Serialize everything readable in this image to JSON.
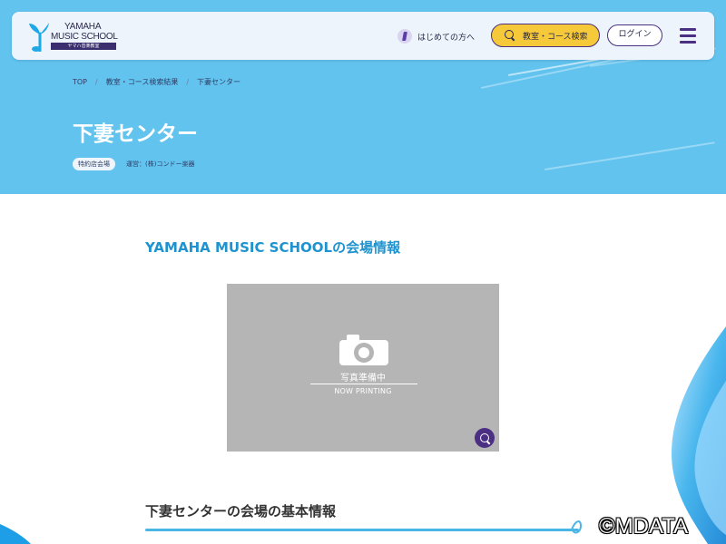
{
  "header": {
    "logo": {
      "line1": "YAMAHA",
      "line2": "MUSIC SCHOOL",
      "sub": "ヤマハ音楽教室"
    },
    "nav_first_label": "はじめての方へ",
    "search_label": "教室・コース検索",
    "login_label": "ログイン"
  },
  "breadcrumb": {
    "items": [
      "TOP",
      "教室・コース検索結果",
      "下妻センター"
    ],
    "separator": "/"
  },
  "page": {
    "title": "下妻センター",
    "tag": "特約店会場",
    "operator": "運営：(株)コンドー楽器"
  },
  "venue_section": {
    "heading": "YAMAHA MUSIC SCHOOLの会場情報",
    "photo_jp": "写真準備中",
    "photo_en": "NOW PRINTING"
  },
  "basic_info": {
    "heading": "下妻センターの会場の基本情報"
  },
  "watermark": "©MDATA",
  "colors": {
    "hero_bg": "#62c3ef",
    "accent_purple": "#4a2f82",
    "search_yellow": "#f5c93a",
    "heading_blue": "#1e93cf"
  }
}
